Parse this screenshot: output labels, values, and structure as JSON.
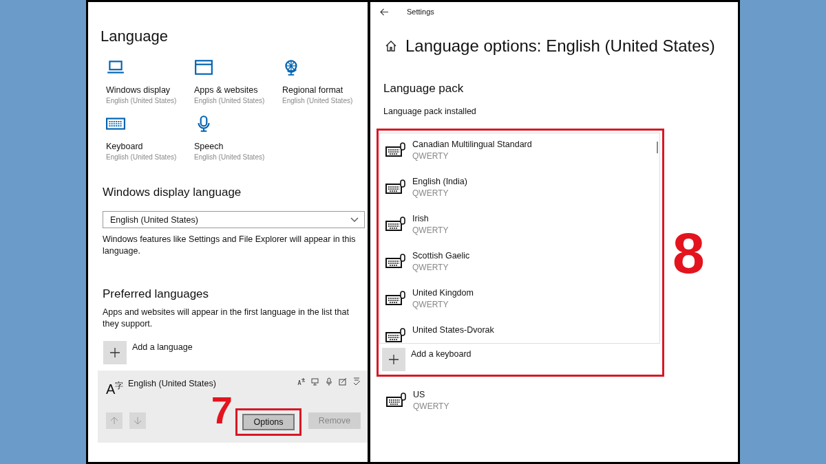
{
  "language_page": {
    "title": "Language",
    "tiles": [
      {
        "kind": "laptop",
        "label": "Windows display",
        "value": "English (United States)"
      },
      {
        "kind": "window",
        "label": "Apps & websites",
        "value": "English (United States)"
      },
      {
        "kind": "globe",
        "label": "Regional format",
        "value": "English (United States)"
      },
      {
        "kind": "keyboard",
        "label": "Keyboard",
        "value": "English (United States)"
      },
      {
        "kind": "microphone",
        "label": "Speech",
        "value": "English (United States)"
      }
    ],
    "display_language": {
      "heading": "Windows display language",
      "dropdown_value": "English (United States)",
      "description": "Windows features like Settings and File Explorer will appear in this language."
    },
    "preferred": {
      "heading": "Preferred languages",
      "description": "Apps and websites will appear in the first language in the list that they support.",
      "add_label": "Add a language",
      "languages": [
        {
          "glyph": "A$^{字}$",
          "name": "English (United States)",
          "selected": true,
          "move_up": {
            "disabled": true
          },
          "move_down": {
            "disabled": true
          },
          "buttons": [
            {
              "label": "Options",
              "disabled": false,
              "highlighted": true,
              "annotation": "7"
            },
            {
              "label": "Remove",
              "disabled": true,
              "highlighted": false
            }
          ]
        }
      ]
    }
  },
  "options_page": {
    "back_label": "Settings",
    "title": "Language options: English (United States)",
    "section": "Language pack",
    "status": "Language pack installed",
    "keyboards": {
      "highlighted": true,
      "annotation": "8",
      "add_label": "Add a keyboard",
      "items": [
        {
          "name": "Canadian Multilingual Standard",
          "layout": "QWERTY"
        },
        {
          "name": "English (India)",
          "layout": "QWERTY"
        },
        {
          "name": "Irish",
          "layout": "QWERTY"
        },
        {
          "name": "Scottish Gaelic",
          "layout": "QWERTY"
        },
        {
          "name": "United Kingdom",
          "layout": "QWERTY"
        },
        {
          "name": "United States-Dvorak"
        }
      ]
    },
    "other_keyboards": [
      {
        "name": "US",
        "layout": "QWERTY"
      }
    ]
  }
}
